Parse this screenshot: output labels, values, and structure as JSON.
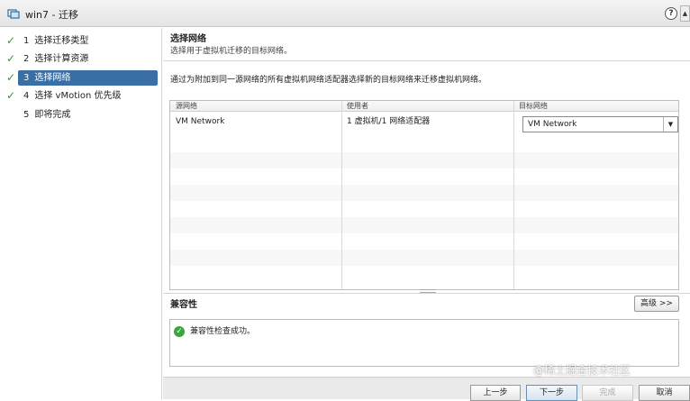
{
  "window": {
    "title": "win7 - 迁移",
    "help_label": "?",
    "scroll_label": "▲"
  },
  "sidebar": {
    "steps": [
      {
        "num": "1",
        "label": "选择迁移类型",
        "done": true
      },
      {
        "num": "2",
        "label": "选择计算资源",
        "done": true
      },
      {
        "num": "3",
        "label": "选择网络",
        "done": true,
        "active": true
      },
      {
        "num": "4",
        "label": "选择 vMotion 优先级",
        "done": true
      },
      {
        "num": "5",
        "label": "即将完成",
        "done": false
      }
    ],
    "check_mark": "✓"
  },
  "main": {
    "heading": "选择网络",
    "subheading": "选择用于虚拟机迁移的目标网络。",
    "instruction": "通过为附加到同一源网络的所有虚拟机网络适配器选择新的目标网络来迁移虚拟机网络。",
    "table": {
      "columns": [
        "源网络",
        "使用者",
        "目标网络"
      ],
      "rows": [
        {
          "source": "VM Network",
          "used_by": "1 虚拟机/1 网络适配器",
          "destination": "VM Network"
        }
      ],
      "dropdown_arrow": "▼"
    },
    "advanced_button": "高级 >>",
    "compatibility": {
      "title": "兼容性",
      "status_icon": "✓",
      "message": "兼容性检查成功。"
    }
  },
  "footer": {
    "back": "上一步",
    "next": "下一步",
    "finish": "完成",
    "cancel": "取消"
  },
  "watermark": "@稀土掘金技术社区"
}
